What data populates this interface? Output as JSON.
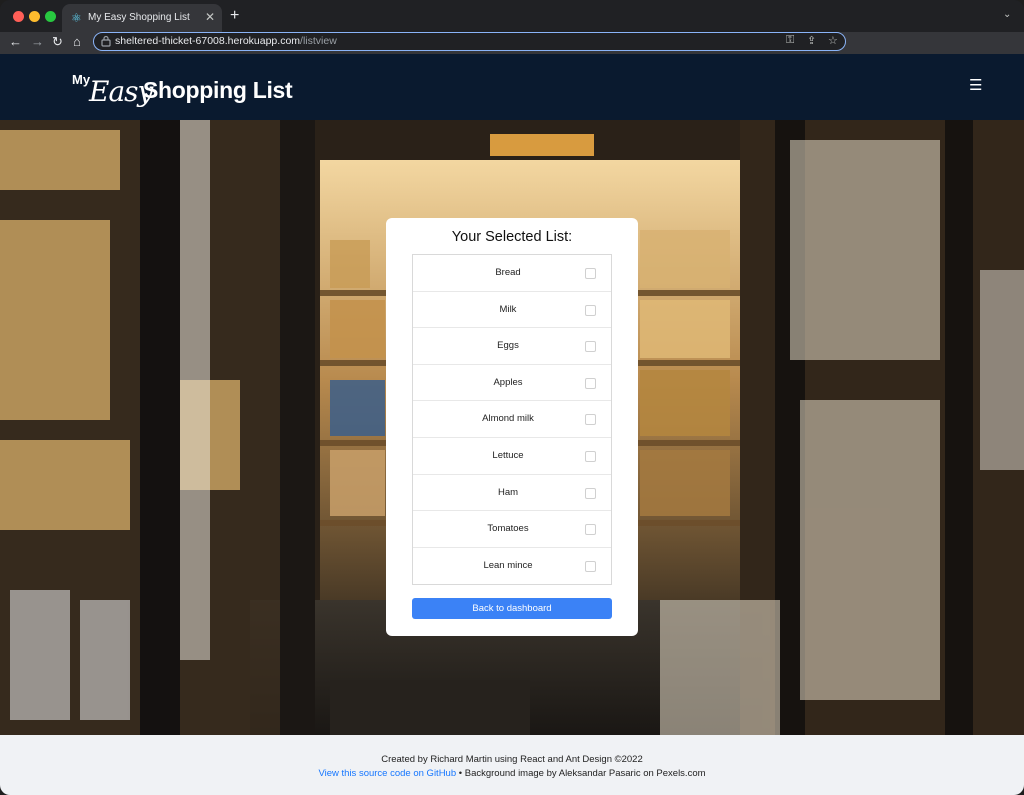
{
  "browser": {
    "tab_title": "My Easy Shopping List",
    "url_host": "sheltered-thicket-67008.herokuapp.com",
    "url_path": "/listview"
  },
  "header": {
    "logo_my": "My",
    "logo_easy": "Easy",
    "logo_rest": "Shopping List"
  },
  "card": {
    "title": "Your Selected List:",
    "items": [
      {
        "label": "Bread",
        "checked": false
      },
      {
        "label": "Milk",
        "checked": false
      },
      {
        "label": "Eggs",
        "checked": false
      },
      {
        "label": "Apples",
        "checked": false
      },
      {
        "label": "Almond milk",
        "checked": false
      },
      {
        "label": "Lettuce",
        "checked": false
      },
      {
        "label": "Ham",
        "checked": false
      },
      {
        "label": "Tomatoes",
        "checked": false
      },
      {
        "label": "Lean mince",
        "checked": false
      }
    ],
    "back_button": "Back to dashboard"
  },
  "footer": {
    "line1": "Created by Richard Martin using React and Ant Design ©2022",
    "link": "View this source code on GitHub",
    "line2_rest": " • Background image by Aleksandar Pasaric on Pexels.com"
  },
  "colors": {
    "header_bg": "#0a1a2f",
    "accent": "#3b82f6",
    "link": "#1677ff",
    "footer_bg": "#f0f2f5"
  }
}
